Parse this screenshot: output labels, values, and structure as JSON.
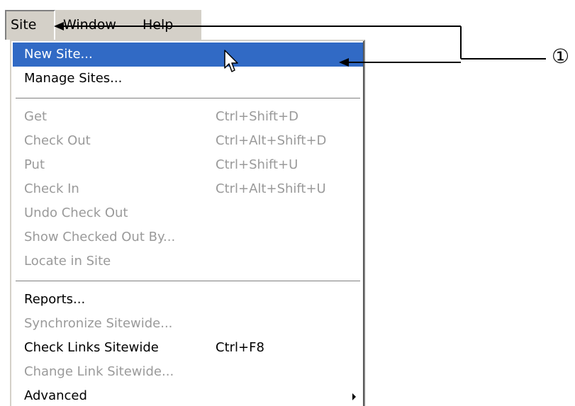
{
  "menubar": {
    "items": [
      {
        "label": "Site"
      },
      {
        "label": "Window"
      },
      {
        "label": "Help"
      }
    ]
  },
  "site_menu": {
    "items": [
      {
        "label": "New Site...",
        "shortcut": "",
        "state": "highlighted"
      },
      {
        "label": "Manage Sites...",
        "shortcut": "",
        "state": "enabled"
      },
      {
        "label": "Get",
        "shortcut": "Ctrl+Shift+D",
        "state": "disabled"
      },
      {
        "label": "Check Out",
        "shortcut": "Ctrl+Alt+Shift+D",
        "state": "disabled"
      },
      {
        "label": "Put",
        "shortcut": "Ctrl+Shift+U",
        "state": "disabled"
      },
      {
        "label": "Check In",
        "shortcut": "Ctrl+Alt+Shift+U",
        "state": "disabled"
      },
      {
        "label": "Undo Check Out",
        "shortcut": "",
        "state": "disabled"
      },
      {
        "label": "Show Checked Out By...",
        "shortcut": "",
        "state": "disabled"
      },
      {
        "label": "Locate in Site",
        "shortcut": "",
        "state": "disabled"
      },
      {
        "label": "Reports...",
        "shortcut": "",
        "state": "enabled"
      },
      {
        "label": "Synchronize Sitewide...",
        "shortcut": "",
        "state": "disabled"
      },
      {
        "label": "Check Links Sitewide",
        "shortcut": "Ctrl+F8",
        "state": "enabled"
      },
      {
        "label": "Change Link Sitewide...",
        "shortcut": "",
        "state": "disabled"
      },
      {
        "label": "Advanced",
        "shortcut": "",
        "state": "enabled",
        "has_submenu": true
      }
    ]
  },
  "annotation": {
    "marker": "①"
  },
  "colors": {
    "menubar_bg": "#d4d0c8",
    "highlight": "#316ac5",
    "disabled_text": "#9a9a9a"
  },
  "icons": {
    "cursor": "arrow-cursor-icon",
    "submenu": "submenu-arrow-icon"
  }
}
